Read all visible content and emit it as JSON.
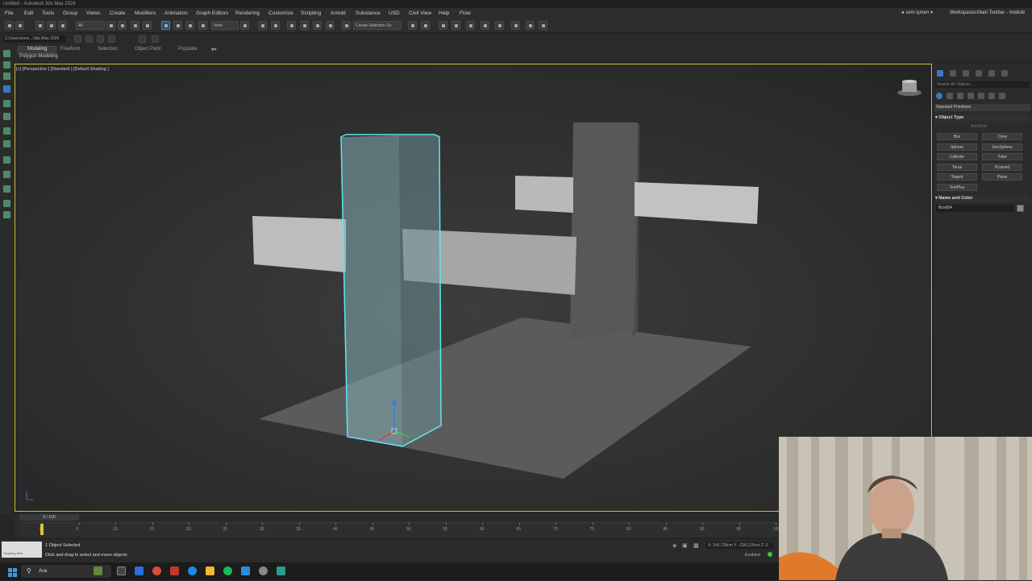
{
  "window": {
    "title": "Untitled - Autodesk 3ds Max 2026"
  },
  "menu": {
    "items": [
      "File",
      "Edit",
      "Tools",
      "Group",
      "Views",
      "Create",
      "Modifiers",
      "Animation",
      "Graph Editors",
      "Rendering",
      "Customize",
      "Scripting",
      "Arnold",
      "Substance",
      "USD",
      "Civil View",
      "Help",
      "Flow"
    ],
    "user": "cem işmen",
    "workspaces_label": "Workspaces:",
    "workspace_value": "Main Toolbar - module"
  },
  "toolbar": {
    "selection_filter": "All",
    "reference_coord": "View",
    "named_selection": "Create Selection Se"
  },
  "ribbon": {
    "path": "C:\\Users\\cem...\\3ds Max 2026",
    "tabs": [
      "Modeling",
      "Freeform",
      "Selection",
      "Object Paint",
      "Populate"
    ],
    "active_tab": "Modeling",
    "panel_label": "Polygon Modeling"
  },
  "viewport": {
    "label": "[+] [Perspective ] [Standard ] [Default Shading ]"
  },
  "command_panel": {
    "search_placeholder": "Search All Objects...",
    "category": "Standard Primitives",
    "object_type_title": "Object Type",
    "autogrid": "AutoGrid",
    "primitives": [
      "Box",
      "Cone",
      "Sphere",
      "GeoSphere",
      "Cylinder",
      "Tube",
      "Torus",
      "Pyramid",
      "Teapot",
      "Plane",
      "TextPlus"
    ],
    "name_color_title": "Name and Color",
    "object_name": "Box004"
  },
  "timeline": {
    "frame_display": "0 / 100",
    "ticks": [
      "0",
      "5",
      "10",
      "15",
      "20",
      "25",
      "30",
      "35",
      "40",
      "45",
      "50",
      "55",
      "60",
      "65",
      "70",
      "75",
      "80",
      "85",
      "90",
      "95",
      "100"
    ]
  },
  "status": {
    "maxscript_label": "Scripting Mini",
    "selected": "1 Object Selected",
    "prompt": "Click and drag to select and move objects",
    "coordinates": "X: 145,738cm  Y: -236,126cm  Z: 0",
    "enabled": "Enabled:"
  },
  "taskbar": {
    "search_label": "Ara"
  },
  "colors": {
    "selection_outline": "#5ee6f0",
    "viewport_border": "#c9c136",
    "time_cursor": "#d9c23a"
  }
}
